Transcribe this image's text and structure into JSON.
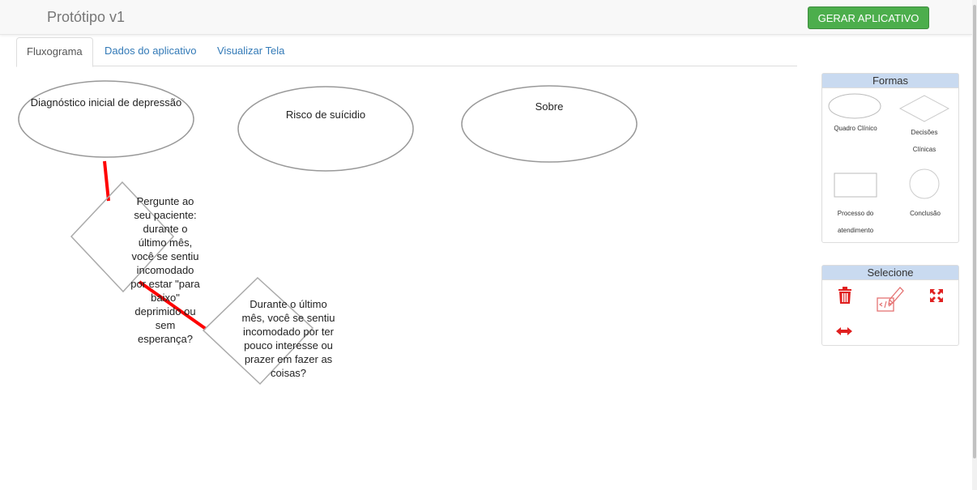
{
  "header": {
    "title": "Protótipo v1",
    "generate_button": "GERAR APLICATIVO"
  },
  "tabs": [
    {
      "label": "Fluxograma",
      "active": true
    },
    {
      "label": "Dados do aplicativo",
      "active": false
    },
    {
      "label": "Visualizar Tela",
      "active": false
    }
  ],
  "flowchart": {
    "nodes": {
      "diagnostico": "Diagnóstico inicial de depressão",
      "risco": "Risco de suícidio",
      "sobre": "Sobre",
      "pergunta1": "Pergunte ao seu paciente: durante o último mês, você se sentiu incomodado por estar \"para baixo\" deprimido ou sem esperança?",
      "pergunta2": "Durante o último mês, você se sentiu incomodado por ter pouco interesse ou prazer em fazer as coisas?"
    },
    "connector_color": "#ff0000"
  },
  "shapes_panel": {
    "title": "Formas",
    "items": {
      "quadro": "Quadro Clínico",
      "decisoes": "Decisões Clínicas",
      "processo": "Processo do atendimento",
      "conclusao": "Conclusão"
    }
  },
  "select_panel": {
    "title": "Selecione",
    "tools": [
      "trash-icon",
      "edit-code-icon",
      "resize-icon",
      "horizontal-arrows-icon"
    ],
    "tool_color": "#e02020"
  }
}
